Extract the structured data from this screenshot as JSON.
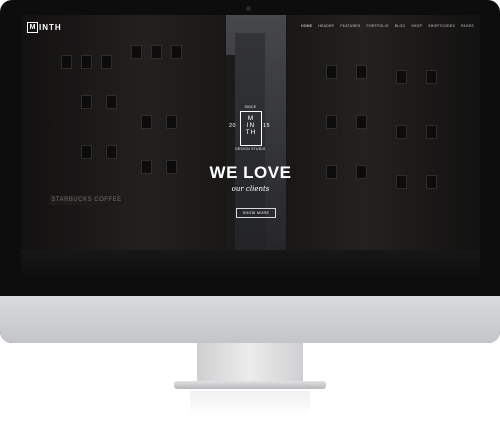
{
  "brand": {
    "logo_mark": "M",
    "logo_rest": "INTH"
  },
  "nav": {
    "items": [
      {
        "label": "HOME",
        "active": true
      },
      {
        "label": "HEADER",
        "active": false
      },
      {
        "label": "FEATURES",
        "active": false
      },
      {
        "label": "PORTFOLIO",
        "active": false
      },
      {
        "label": "BLOG",
        "active": false
      },
      {
        "label": "SHOP",
        "active": false
      },
      {
        "label": "SHORTCODES",
        "active": false
      },
      {
        "label": "PAGES",
        "active": false
      }
    ]
  },
  "hero": {
    "emblem_top": "SINCE",
    "emblem_letters": "M\nIN\nTH",
    "emblem_year_left": "20",
    "emblem_year_right": "15",
    "emblem_bottom": "DESIGN STUDIO",
    "title": "WE LOVE",
    "subtitle": "our clients",
    "button_label": "SHOW MORE"
  },
  "background": {
    "storefront_sign": "STARBUCKS COFFEE"
  },
  "colors": {
    "frame": "#0d0d0d",
    "chin": "#c9cacd",
    "hero_text": "#ffffff"
  }
}
